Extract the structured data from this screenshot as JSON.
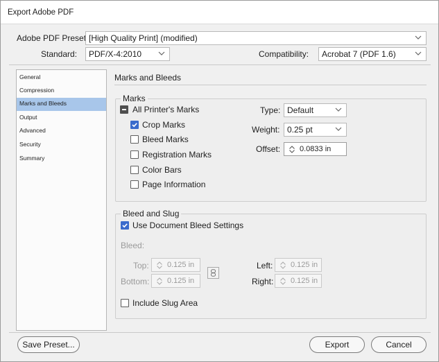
{
  "window": {
    "title": "Export Adobe PDF"
  },
  "header": {
    "preset_label": "Adobe PDF Preset:",
    "preset_value": "[High Quality Print] (modified)",
    "standard_label": "Standard:",
    "standard_value": "PDF/X-4:2010",
    "compat_label": "Compatibility:",
    "compat_value": "Acrobat 7 (PDF 1.6)"
  },
  "sidebar": {
    "items": [
      {
        "label": "General",
        "selected": false
      },
      {
        "label": "Compression",
        "selected": false
      },
      {
        "label": "Marks and Bleeds",
        "selected": true
      },
      {
        "label": "Output",
        "selected": false
      },
      {
        "label": "Advanced",
        "selected": false
      },
      {
        "label": "Security",
        "selected": false
      },
      {
        "label": "Summary",
        "selected": false
      }
    ]
  },
  "main": {
    "section_title": "Marks and Bleeds",
    "marks": {
      "group_label": "Marks",
      "all_printers_marks": {
        "label": "All Printer's Marks",
        "state": "mixed"
      },
      "crop_marks": {
        "label": "Crop Marks",
        "checked": true
      },
      "bleed_marks": {
        "label": "Bleed Marks",
        "checked": false
      },
      "registration_marks": {
        "label": "Registration Marks",
        "checked": false
      },
      "color_bars": {
        "label": "Color Bars",
        "checked": false
      },
      "page_information": {
        "label": "Page Information",
        "checked": false
      },
      "type_label": "Type:",
      "type_value": "Default",
      "weight_label": "Weight:",
      "weight_value": "0.25 pt",
      "offset_label": "Offset:",
      "offset_value": "0.0833 in"
    },
    "bleed_slug": {
      "group_label": "Bleed and Slug",
      "use_doc_bleed": {
        "label": "Use Document Bleed Settings",
        "checked": true
      },
      "bleed_label": "Bleed:",
      "top_label": "Top:",
      "top_value": "0.125 in",
      "bottom_label": "Bottom:",
      "bottom_value": "0.125 in",
      "left_label": "Left:",
      "left_value": "0.125 in",
      "right_label": "Right:",
      "right_value": "0.125 in",
      "include_slug": {
        "label": "Include Slug Area",
        "checked": false
      }
    }
  },
  "footer": {
    "save_preset": "Save Preset...",
    "export": "Export",
    "cancel": "Cancel"
  },
  "colors": {
    "accent": "#3a6bcc",
    "selection": "#a8c6ea"
  }
}
